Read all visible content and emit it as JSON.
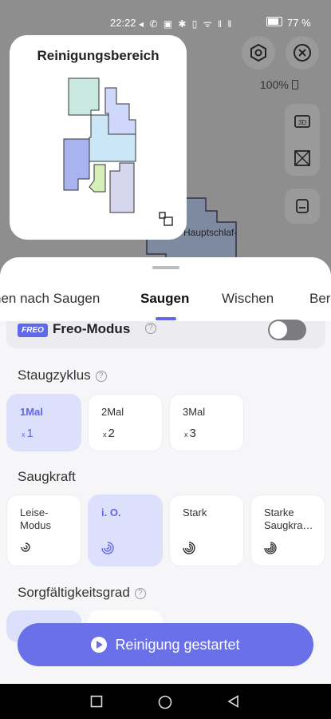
{
  "status_bar": {
    "time": "22:22",
    "icons": "◂ ✆ ▣ ✱ ▯ ᯤ ‖ ‖",
    "battery": "77 %"
  },
  "map": {
    "battery_level": "100%",
    "room_label": "Hauptschlaf-"
  },
  "minimap": {
    "title": "Reinigungsbereich"
  },
  "tabs": [
    "hen nach Saugen",
    "Saugen",
    "Wischen",
    "Ber"
  ],
  "active_tab": "Saugen",
  "freo": {
    "badge": "FREO",
    "label": "Freo-Modus",
    "enabled": false
  },
  "staugzyklus": {
    "title": "Staugzyklus",
    "options": [
      {
        "label": "1Mal",
        "value": "1",
        "selected": true
      },
      {
        "label": "2Mal",
        "value": "2",
        "selected": false
      },
      {
        "label": "3Mal",
        "value": "3",
        "selected": false
      }
    ],
    "multiplier": "x"
  },
  "saugkraft": {
    "title": "Saugkraft",
    "options": [
      {
        "label_line1": "Leise-",
        "label_line2": "Modus",
        "selected": false
      },
      {
        "label_line1": "i. O.",
        "label_line2": "",
        "selected": true
      },
      {
        "label_line1": "Stark",
        "label_line2": "",
        "selected": false
      },
      {
        "label_line1": "Starke",
        "label_line2": "Saugkra…",
        "selected": false
      }
    ]
  },
  "sorgfalt": {
    "title": "Sorgfältigkeitsgrad"
  },
  "start_button": {
    "label": "Reinigung gestartet"
  },
  "colors": {
    "accent": "#5f68e6",
    "selected_bg": "#dde0fb"
  }
}
